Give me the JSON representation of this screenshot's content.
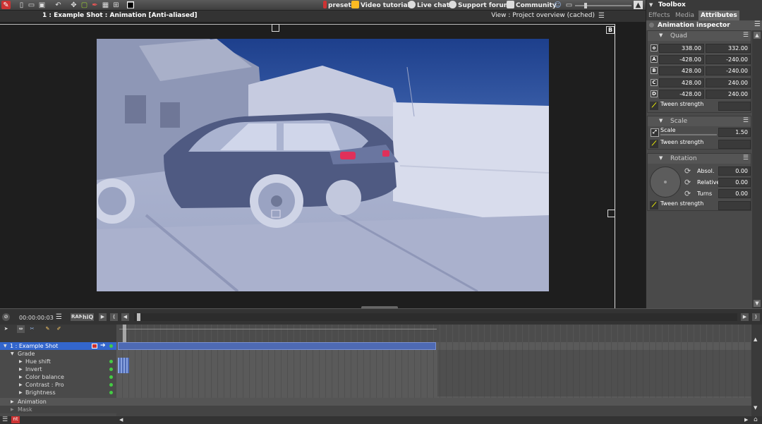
{
  "toolbar": {
    "preset": "preset",
    "video_tutorials": "Video tutorials",
    "live_chat": "Live chat",
    "support_forums": "Support forums",
    "community": "Community"
  },
  "viewer": {
    "title": "1 : Example Shot : Animation [Anti-aliased]",
    "mode": "View : Project overview (cached)",
    "frame_label": "B"
  },
  "toolbox": {
    "title": "Toolbox",
    "tabs": [
      "Effects",
      "Media",
      "Attributes"
    ],
    "inspector_title": "Animation inspector",
    "quad": {
      "label": "Quad",
      "rows": [
        {
          "pt": "o",
          "x": "338.00",
          "y": "332.00"
        },
        {
          "pt": "A",
          "x": "-428.00",
          "y": "-240.00"
        },
        {
          "pt": "B",
          "x": "428.00",
          "y": "-240.00"
        },
        {
          "pt": "C",
          "x": "428.00",
          "y": "240.00"
        },
        {
          "pt": "D",
          "x": "-428.00",
          "y": "240.00"
        }
      ],
      "tween": "Tween strength"
    },
    "scale": {
      "label": "Scale",
      "field_label": "Scale",
      "value": "1.50",
      "tween": "Tween strength"
    },
    "rotation": {
      "label": "Rotation",
      "absol_label": "Absol.",
      "absol": "0.00",
      "relative_label": "Relative",
      "relative": "0.00",
      "turns_label": "Turns",
      "turns": "0.00",
      "tween": "Tween strength"
    }
  },
  "transport": {
    "timecode": "00:00:00:03",
    "ram": "RAM",
    "hiq": "hiQ"
  },
  "timeline": {
    "rows": [
      {
        "name": "1 : Example Shot",
        "indent": 0,
        "selected": true
      },
      {
        "name": "Grade",
        "indent": 1
      },
      {
        "name": "Hue shift",
        "indent": 2
      },
      {
        "name": "Invert",
        "indent": 2
      },
      {
        "name": "Color balance",
        "indent": 2
      },
      {
        "name": "Contrast : Pro",
        "indent": 2
      },
      {
        "name": "Brightness",
        "indent": 2
      },
      {
        "name": "Animation",
        "indent": 1
      },
      {
        "name": "Mask",
        "indent": 1
      }
    ]
  },
  "colors": {
    "accent": "#3366cc",
    "panel": "#4a4a4a",
    "viewer_bg": "#1e1e1e"
  }
}
